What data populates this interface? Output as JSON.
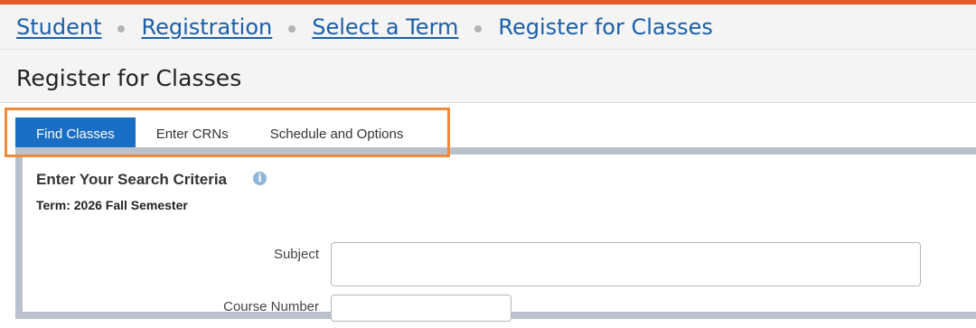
{
  "colors": {
    "accent_bar": "#e8592a",
    "link": "#1a5fa8",
    "tab_active": "#1a6fc4",
    "highlight_box": "#f08a3a"
  },
  "breadcrumb": {
    "items": [
      {
        "label": "Student"
      },
      {
        "label": "Registration"
      },
      {
        "label": "Select a Term"
      }
    ],
    "current": "Register for Classes"
  },
  "page": {
    "title": "Register for Classes"
  },
  "tabs": [
    {
      "label": "Find Classes",
      "active": true
    },
    {
      "label": "Enter CRNs",
      "active": false
    },
    {
      "label": "Schedule and Options",
      "active": false
    }
  ],
  "search": {
    "title": "Enter Your Search Criteria",
    "info_icon": "info-icon",
    "term": "Term: 2026 Fall Semester",
    "fields": [
      {
        "label": "Subject",
        "value": ""
      },
      {
        "label": "Course Number",
        "value": ""
      }
    ]
  }
}
